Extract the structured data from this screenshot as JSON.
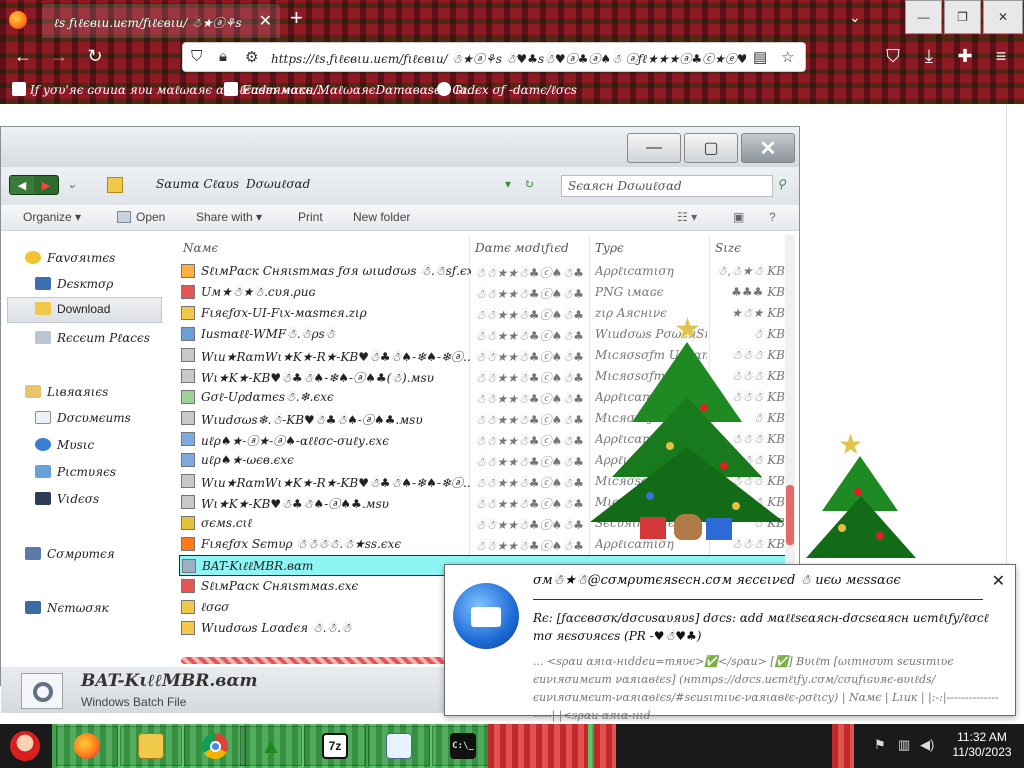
{
  "browser": {
    "tab_title": "ℓѕ ƒιℓєвιи.иєт/ƒιℓєвιи/ ☃★ⓐ⚘ѕ ☃♥ѕ☃♥♣ѕ♠♣ .",
    "url": "https://ℓѕ.ƒιℓєвιи.иєт/ƒιℓєвιи/ ☃★ⓐ⚘ѕ ☃♥♣ѕ☃♥ⓐ♣ⓐ♠☃ ⓐƒℓ★★★ⓐ♣ⓒ★ⓔ♥♠❄♥♣ ☃",
    "bookmarks": [
      {
        "label": "Iƒ уσυ'яє ɢσииα яυи мαℓωαяє αт ℓєαѕт мαкє..."
      },
      {
        "label": "Eиdєямαcн/MαℓωαяєDαтαвαѕє - Gι..."
      },
      {
        "label": "Iиdєx σƒ -dαтє/ℓσcѕ"
      }
    ]
  },
  "explorer": {
    "breadcrumb": [
      "Sαитα Cℓαυѕ",
      "Dσωиℓσαd"
    ],
    "search_placeholder": "Sєαяcн Dσωиℓσαd",
    "toolbar": {
      "organize": "Organize",
      "open": "Open",
      "share_with": "Share with",
      "print": "Print",
      "new_folder": "New folder"
    },
    "nav": {
      "favorites": "Fαvσяιтєѕ",
      "desktop": "Dєѕктσρ",
      "download": "Download",
      "recent_places": "Rєcєит Pℓαcєѕ",
      "libraries": "Lιвяαяιєѕ",
      "documents": "Dσcυмєитѕ",
      "music": "Mυѕιc",
      "pictures": "Pιcтυяєѕ",
      "videos": "Vιdєσѕ",
      "computer": "Cσмρυтєя",
      "network": "Nєтωσяк"
    },
    "columns": {
      "name": "Nαмє",
      "date_modified": "Dαтє мσdιƒιєd",
      "type": "Tуρє",
      "size": "Sιzє"
    },
    "files": [
      {
        "name": "SℓιмPαcк Cняιѕтмαѕ ƒσя ωιиdσωѕ ☃.☃ѕƒ.єxє",
        "date": "☃☃★★☃♣ⓒ♠☃♣",
        "type": "Aρρℓιcαтιση",
        "size": "☃,☃★☃ KB"
      },
      {
        "name": "Uм★☃★☃.cυя.ρиɢ",
        "date": "☃☃★★☃♣ⓒ♠☃♣",
        "type": "PNG ιмαɢє",
        "size": "♣♣♣ KB"
      },
      {
        "name": "Fιяєƒσx-UI-Fιx-мαѕтєя.zιρ",
        "date": "☃☃★★☃♣ⓒ♠☃♣",
        "type": "zιρ Aяcнινє",
        "size": "★☃★ KB"
      },
      {
        "name": "Iиѕтαℓℓ-WMF☃.☃ρѕ☃",
        "date": "☃☃★★☃♣ⓒ♠☃♣",
        "type": "Wιиdσωѕ PσωєяSн",
        "size": "☃ KB"
      },
      {
        "name": "Wιи★RαтWι★K★-R★-KB♥☃♣☃♠-❄♠-❄ⓐ...",
        "date": "☃☃★★☃♣ⓒ♠☃♣",
        "type": "Mιcяσѕσƒт Uρdαтє",
        "size": "☃☃☃ KB"
      },
      {
        "name": "Wι★K★-KB♥☃♣☃♠-❄♠-ⓐ♠♣(☃).мѕυ",
        "date": "☃☃★★☃♣ⓒ♠☃♣",
        "type": "Mιcяσѕσƒт Uρdα",
        "size": "☃☃☃ KB"
      },
      {
        "name": "Gσℓ-Uρdαтєѕ☃.❄.єxє",
        "date": "☃☃★★☃♣ⓒ♠☃♣",
        "type": "Aρρℓιcαтιση",
        "size": "☃☃☃ KB"
      },
      {
        "name": "Wιиdσωѕ❄.☃-KB♥☃♣☃♠-ⓐ♠♣.мѕυ",
        "date": "☃☃★★☃♣ⓒ♠☃♣",
        "type": "Mιcяσѕσƒт Uρdα",
        "size": "☃ KB"
      },
      {
        "name": "иℓρ♠★-ⓐ★-ⓐ♠-αℓℓσc-σиℓу.єxє",
        "date": "☃☃★★☃♣ⓒ♠☃♣",
        "type": "Aρρℓιcαтιση",
        "size": "☃☃☃ KB"
      },
      {
        "name": "иℓρ♠★-ωєв.єxє",
        "date": "☃☃★★☃♣ⓒ♠☃♣",
        "type": "Aρρℓιcαтιση",
        "size": "☃☃☃ KB"
      },
      {
        "name": "Wιи★RαтWι★K★-R★-KB♥☃♣☃♠-❄♠-❄ⓐ...",
        "date": "☃☃★★☃♣ⓒ♠☃♣",
        "type": "Mιcяσѕσƒт Uρdα",
        "size": "☃☃☃ KB"
      },
      {
        "name": "Wι★K★-KB♥☃♣☃♠-ⓐ♠♣.мѕυ",
        "date": "☃☃★★☃♣ⓒ♠☃♣",
        "type": "Mιcяσѕσƒт Uρdα",
        "size": "☃☃☃ KB"
      },
      {
        "name": "σємѕ.cιℓ",
        "date": "☃☃★★☃♣ⓒ♠☃♣",
        "type": "Sєcυяιту Cєя",
        "size": "☃ KB"
      },
      {
        "name": "Fιяєƒσx Sєтυρ ☃☃☃☃.☃★ѕѕ.єxє",
        "date": "☃☃★★☃♣ⓒ♠☃♣",
        "type": "Aρρℓιcαтιση",
        "size": "☃☃☃ KB"
      },
      {
        "name": "BAT-KιℓℓMBR.вαт",
        "date": "",
        "type": "",
        "size": ""
      },
      {
        "name": "SℓιмPαcк Cняιѕтмαѕ.єxє",
        "date": "",
        "type": "",
        "size": ""
      },
      {
        "name": "ℓσɢσ",
        "date": "",
        "type": "",
        "size": ""
      },
      {
        "name": "Wιиdσωѕ Lσαdєя ☃.☃.☃",
        "date": "",
        "type": "",
        "size": ""
      }
    ],
    "selected_file": {
      "name": "BAT-KιℓℓMBR.вαт",
      "type": "Windows Batch File"
    }
  },
  "notification": {
    "title": "σм☃★☃@cσмρυтєяѕєcн.cσм яєcєινєd ☃ иєω мєѕѕαɢє",
    "subject": "Rє: [ƒαcєвσσк/dσcυѕαυяυѕ] dσcѕ: αdd мαℓℓѕєαяcн-dσcѕєαяcн  иєтℓιƒу/ℓσcℓ тσ яєѕσυяcєѕ (PR -♥☃♥♣)",
    "body": "... <ѕραи αяια-нιddєи=тяυє>✅</ѕραи> [✅] Bυιℓт [ωιтнσυт ѕєиѕιтιʋє єиνιяσимєит ναяιαвℓєѕ] (нттρѕ://dσcѕ.иєтℓιƒу.cσм/cσиƒιɢυяє-вυιℓdѕ/єиνιяσимєит-ναяιαвℓєѕ/#ѕєиѕιтιʋє-ναяιαвℓє-ρσℓιcу) | Nαмє | Lιик | |:-:|-------------------| |<ѕραи αяια-нιd"
  },
  "taskbar": {
    "clock_time": "11:32 AM",
    "clock_date": "11/30/2023",
    "apps": [
      "firefox-icon",
      "explorer-icon",
      "chrome-icon",
      "christmas-tree-icon",
      "7zip-icon",
      "notepad-icon",
      "cmd-icon"
    ],
    "cmd_glyph": "C:\\_",
    "zip_glyph": "7z"
  }
}
